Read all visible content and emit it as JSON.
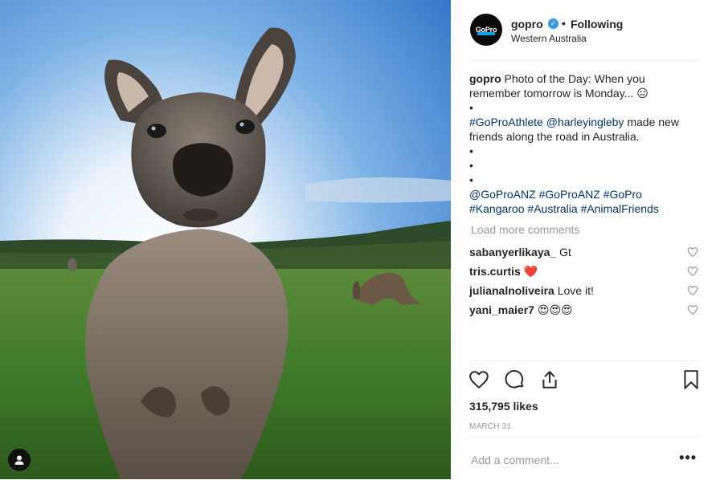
{
  "post": {
    "username": "gopro",
    "avatar_text": "GoPro",
    "separator": "•",
    "follow_status": "Following",
    "location": "Western Australia"
  },
  "caption": {
    "username": "gopro",
    "line1": "Photo of the Day: When you",
    "line2": "remember tomorrow is Monday... 😐",
    "bullet": "•",
    "hashtag_athlete": "#GoProAthlete",
    "mention_harley": "@harleyingleby",
    "line3_rest": " made new",
    "line4": "friends along the road in Australia.",
    "tag_anz1": "@GoProANZ",
    "tag_anz2": "#GoProANZ",
    "tag_gopro": "#GoPro",
    "tag_kangaroo": "#Kangaroo",
    "tag_australia": "#Australia",
    "tag_animal": "#AnimalFriends"
  },
  "load_more": "Load more comments",
  "comments": [
    {
      "user": "sabanyerlikaya_",
      "text": "Gt"
    },
    {
      "user": "tris.curtis",
      "text": "❤️"
    },
    {
      "user": "julianalnoliveira",
      "text": "Love it!"
    },
    {
      "user": "yani_maier7",
      "text": "😍😍😍"
    }
  ],
  "likes": "315,795 likes",
  "date": "MARCH 31",
  "add_comment": {
    "placeholder": "Add a comment..."
  },
  "more_options": "•••",
  "icons": {
    "like": "heart-icon",
    "comment": "comment-icon",
    "share": "share-icon",
    "save": "bookmark-icon",
    "user_tag": "user-icon"
  }
}
